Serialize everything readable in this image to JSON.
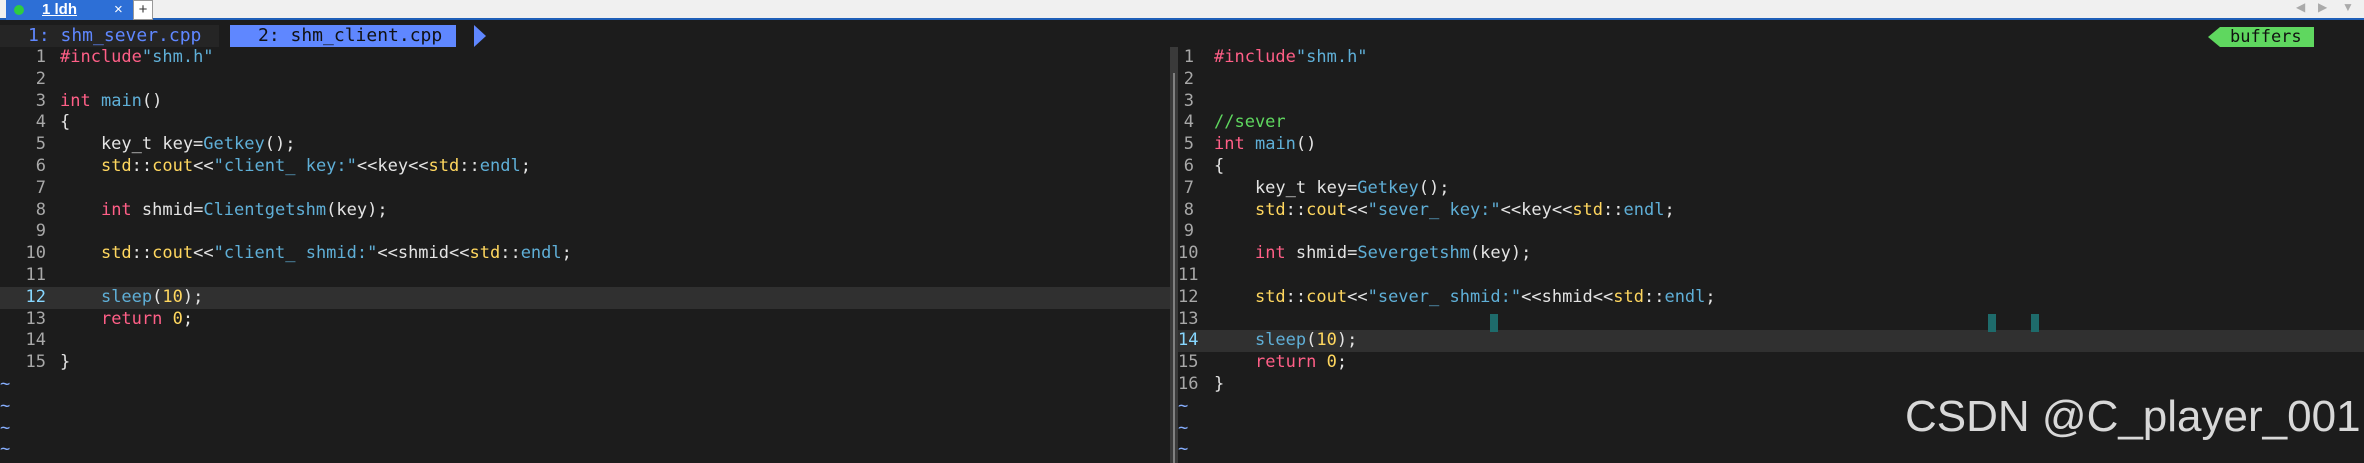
{
  "terminal_tab": {
    "label": "1 ldh",
    "close": "×",
    "new_tab": "+"
  },
  "buffer_line": {
    "buffer1": "1: shm_sever.cpp",
    "buffer2": "2: shm_client.cpp",
    "buffers_label": "buffers"
  },
  "left_pane": {
    "file": "shm_client.cpp",
    "current_line": 12,
    "lines": [
      {
        "n": "1",
        "t": "#include\"shm.h\""
      },
      {
        "n": "2",
        "t": ""
      },
      {
        "n": "3",
        "t": "int main()"
      },
      {
        "n": "4",
        "t": "{"
      },
      {
        "n": "5",
        "t": "    key_t key=Getkey();"
      },
      {
        "n": "6",
        "t": "    std::cout<<\"client_ key:\"<<key<<std::endl;"
      },
      {
        "n": "7",
        "t": ""
      },
      {
        "n": "8",
        "t": "    int shmid=Clientgetshm(key);"
      },
      {
        "n": "9",
        "t": ""
      },
      {
        "n": "10",
        "t": "    std::cout<<\"client_ shmid:\"<<shmid<<std::endl;"
      },
      {
        "n": "11",
        "t": ""
      },
      {
        "n": "12",
        "t": "    sleep(10);"
      },
      {
        "n": "13",
        "t": "    return 0;"
      },
      {
        "n": "14",
        "t": ""
      },
      {
        "n": "15",
        "t": "}"
      }
    ],
    "tildes": 4
  },
  "right_pane": {
    "file": "shm_sever.cpp",
    "current_line": 14,
    "lines": [
      {
        "n": "1",
        "t": "#include\"shm.h\""
      },
      {
        "n": "2",
        "t": ""
      },
      {
        "n": "3",
        "t": ""
      },
      {
        "n": "4",
        "t": "//sever"
      },
      {
        "n": "5",
        "t": "int main()"
      },
      {
        "n": "6",
        "t": "{"
      },
      {
        "n": "7",
        "t": "    key_t key=Getkey();"
      },
      {
        "n": "8",
        "t": "    std::cout<<\"sever_ key:\"<<key<<std::endl;"
      },
      {
        "n": "9",
        "t": ""
      },
      {
        "n": "10",
        "t": "    int shmid=Severgetshm(key);"
      },
      {
        "n": "11",
        "t": ""
      },
      {
        "n": "12",
        "t": "    std::cout<<\"sever_ shmid:\"<<shmid<<std::endl;"
      },
      {
        "n": "13",
        "t": ""
      },
      {
        "n": "14",
        "t": "    sleep(10);"
      },
      {
        "n": "15",
        "t": "    return 0;"
      },
      {
        "n": "16",
        "t": "}"
      }
    ],
    "tildes": 3
  },
  "watermark": "CSDN @C_player_001",
  "colors": {
    "background": "#1c1c1c",
    "keyword": "#ff5f87",
    "function": "#5fafd7",
    "namespace": "#ffd75f",
    "comment": "#5fd75f",
    "tilde": "#87afff",
    "buffers_badge": "#5fd75f",
    "active_buffer": "#5f87ff"
  }
}
